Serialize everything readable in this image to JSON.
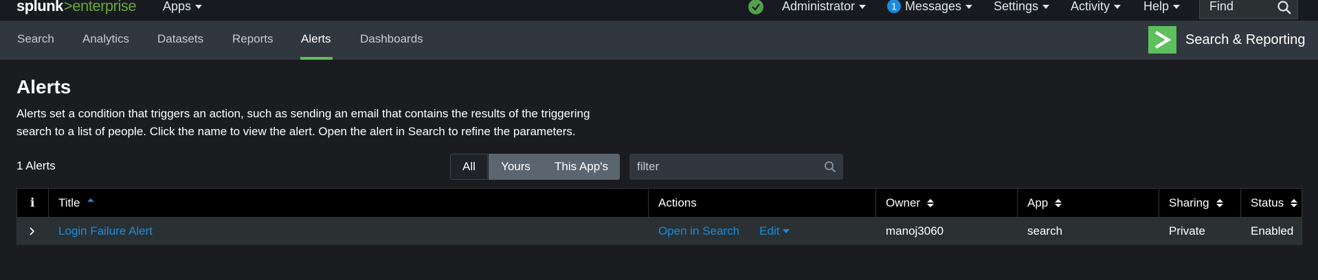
{
  "topbar": {
    "logo_primary": "splunk",
    "logo_gt": ">",
    "logo_secondary": "enterprise",
    "apps_label": "Apps",
    "admin_label": "Administrator",
    "messages_count": "1",
    "messages_label": "Messages",
    "settings_label": "Settings",
    "activity_label": "Activity",
    "help_label": "Help",
    "find_label": "Find"
  },
  "appbar": {
    "tabs": [
      {
        "label": "Search"
      },
      {
        "label": "Analytics"
      },
      {
        "label": "Datasets"
      },
      {
        "label": "Reports"
      },
      {
        "label": "Alerts",
        "active": true
      },
      {
        "label": "Dashboards"
      }
    ],
    "app_name": "Search & Reporting"
  },
  "page": {
    "title": "Alerts",
    "description": "Alerts set a condition that triggers an action, such as sending an email that contains the results of the triggering search to a list of people. Click the name to view the alert. Open the alert in Search to refine the parameters.",
    "count_label": "1 Alerts",
    "filter_buttons": [
      "All",
      "Yours",
      "This App's"
    ],
    "filter_placeholder": "filter"
  },
  "table": {
    "headers": {
      "info": "i",
      "title": "Title",
      "actions": "Actions",
      "owner": "Owner",
      "app": "App",
      "sharing": "Sharing",
      "status": "Status"
    },
    "rows": [
      {
        "title": "Login Failure Alert",
        "open_in_search": "Open in Search",
        "edit": "Edit",
        "owner": "manoj3060",
        "app": "search",
        "sharing": "Private",
        "status": "Enabled"
      }
    ]
  },
  "colors": {
    "accent_green": "#5cc05c",
    "link_blue": "#1a8cdb",
    "background": "#1a1c20"
  }
}
